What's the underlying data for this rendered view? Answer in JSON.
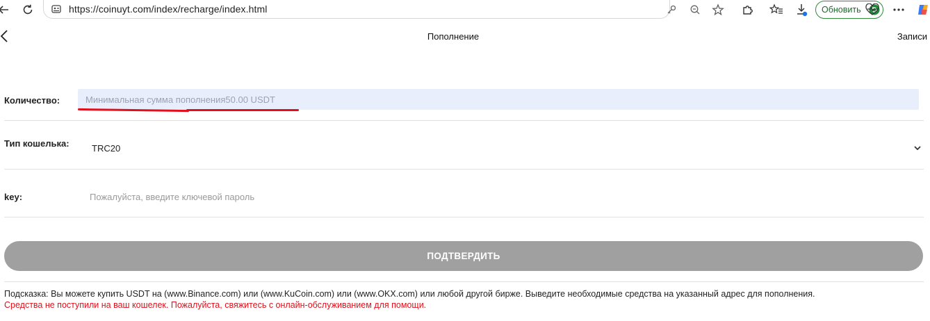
{
  "browser": {
    "url": "https://coinuyt.com/index/recharge/index.html",
    "update_label": "Обновить",
    "icons": {
      "back": "arrow-left-icon",
      "reload": "reload-icon",
      "site_info": "site-info-icon",
      "password": "key-icon",
      "zoom": "zoom-out-icon",
      "favorite": "star-icon",
      "extensions": "puzzle-icon",
      "favorites_bar": "favorites-icon",
      "downloads": "download-icon",
      "health": "heartbeat-icon",
      "menu": "more-icon",
      "copilot": "copilot-icon"
    }
  },
  "header": {
    "title": "Пополнение",
    "records_label": "Записи"
  },
  "form": {
    "amount": {
      "label": "Количество:",
      "placeholder": "Минимальная сумма пополнения50.00 USDT"
    },
    "wallet": {
      "label": "Тип кошелька:",
      "value": "TRC20"
    },
    "key": {
      "label": "key:",
      "placeholder": "Пожалуйста, введите ключевой пароль"
    },
    "confirm_label": "ПОДТВЕРДИТЬ"
  },
  "footer": {
    "hint": "Подсказка: Вы можете купить USDT на (www.Binance.com) или (www.KuCoin.com) или (www.OKX.com) или любой другой бирже. Выведите необходимые средства на указанный адрес для пополнения.",
    "warning": "Средства не поступили на ваш кошелек. Пожалуйста, свяжитесь с онлайн-обслуживанием для помощи."
  },
  "colors": {
    "input_bg": "#e8eefc",
    "annotation_red": "#e0101c",
    "button_gray": "#a0a0a0",
    "update_green": "#2e8b3a"
  }
}
